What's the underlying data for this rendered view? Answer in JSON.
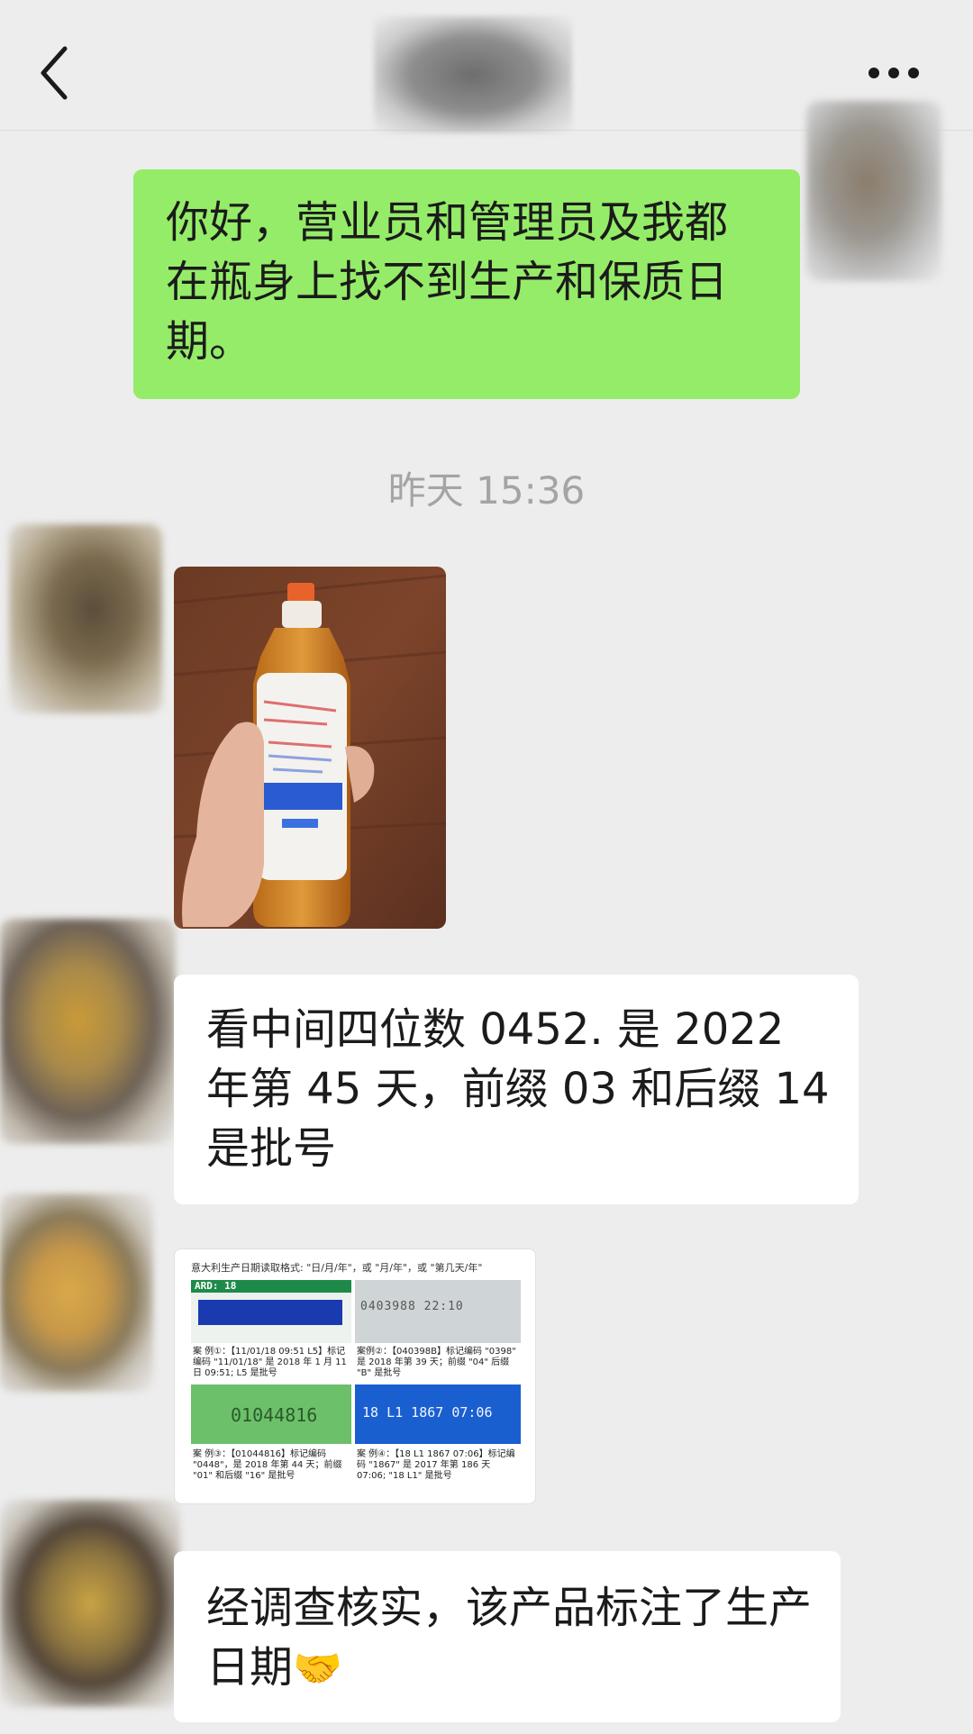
{
  "header": {
    "back_icon": "chevron-left-icon",
    "more_icon": "ellipsis-icon"
  },
  "messages": {
    "outgoing_1": "你好，营业员和管理员及我都在瓶身上找不到生产和保质日期。",
    "timestamp": "昨天 15:36",
    "incoming_2": "看中间四位数 0452. 是 2022 年第 45 天，前缀 03 和后缀 14 是批号",
    "incoming_3": "经调查核实，该产品标注了生产日期",
    "incoming_3_emoji": "🤝"
  },
  "doc_image": {
    "heading": "意大利生产日期读取格式: \"日/月/年\"，或 \"月/年\"，或 \"第几天/年\"",
    "tl_code": "ARD: 18",
    "tr_code": "0403988  22:10",
    "bl_code": "01044816",
    "br_code": "18 L1  1867  07:06",
    "case1": "案 例①：【11/01/18 09:51 L5】标记编码 \"11/01/18\" 是 2018 年 1 月 11 日 09:51; L5 是批号",
    "case2": "案例②：【040398B】标记编码 \"0398\" 是 2018 年第 39 天；前缀 \"04\" 后缀 \"B\" 是批号",
    "case3": "案 例③：【01044816】标记编码 \"0448\"，是 2018 年第 44 天；前缀 \"01\" 和后缀 \"16\" 是批号",
    "case4": "案 例④：【18 L1 1867 07:06】标记编码 \"1867\" 是 2017 年第 186 天 07:06; \"18 L1\" 是批号"
  },
  "colors": {
    "background": "#ededed",
    "outgoing_bubble": "#95ec69",
    "incoming_bubble": "#ffffff",
    "timestamp": "#a4a4a4"
  }
}
